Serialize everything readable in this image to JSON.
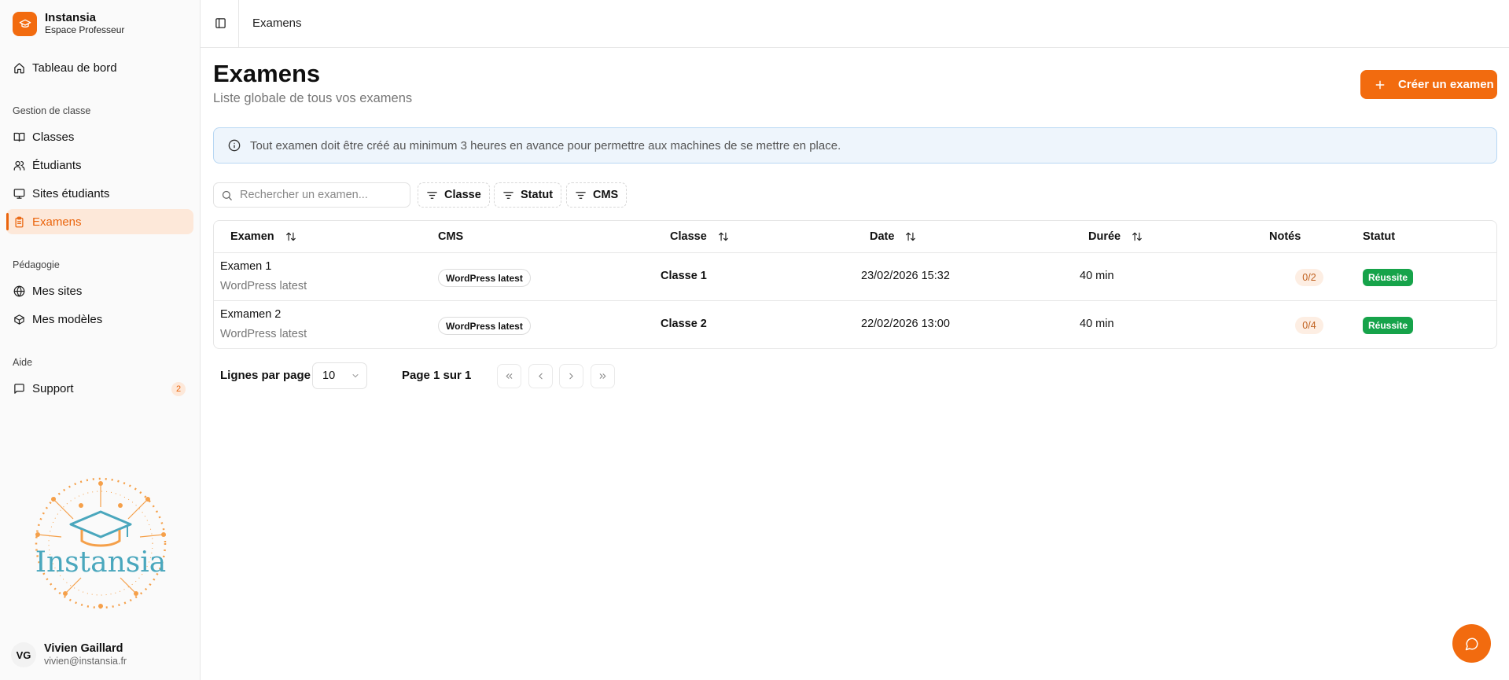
{
  "brand": {
    "name": "Instansia",
    "subtitle": "Espace Professeur"
  },
  "sidebar": {
    "dashboard": "Tableau de bord",
    "sections": [
      {
        "title": "Gestion de classe",
        "items": [
          "Classes",
          "Étudiants",
          "Sites étudiants",
          "Examens"
        ]
      },
      {
        "title": "Pédagogie",
        "items": [
          "Mes sites",
          "Mes modèles"
        ]
      },
      {
        "title": "Aide",
        "items": [
          "Support"
        ]
      }
    ],
    "support_badge": "2",
    "logo_text": "Instansia"
  },
  "user": {
    "initials": "VG",
    "name": "Vivien Gaillard",
    "email": "vivien@instansia.fr"
  },
  "topbar": {
    "breadcrumb": "Examens"
  },
  "page": {
    "title": "Examens",
    "subtitle": "Liste globale de tous vos examens",
    "create_button": "Créer un examen",
    "info": "Tout examen doit être créé au minimum 3 heures en avance pour permettre aux machines de se mettre en place."
  },
  "toolbar": {
    "search_placeholder": "Rechercher un examen...",
    "filters": [
      "Classe",
      "Statut",
      "CMS"
    ]
  },
  "table": {
    "columns": [
      "Examen",
      "CMS",
      "Classe",
      "Date",
      "Durée",
      "Notés",
      "Statut"
    ],
    "rows": [
      {
        "name": "Examen 1",
        "sub": "WordPress latest",
        "cms": "WordPress latest",
        "classe": "Classe 1",
        "date": "23/02/2026 15:32",
        "duree": "40 min",
        "notes": "0/2",
        "statut": "Réussite"
      },
      {
        "name": "Exmamen 2",
        "sub": "WordPress latest",
        "cms": "WordPress latest",
        "classe": "Classe 2",
        "date": "22/02/2026 13:00",
        "duree": "40 min",
        "notes": "0/4",
        "statut": "Réussite"
      }
    ]
  },
  "pagination": {
    "rows_label": "Lignes par page",
    "rows_value": "10",
    "page_info": "Page 1 sur 1"
  },
  "colors": {
    "accent": "#f26b0f",
    "success": "#16a34a",
    "info_bg": "#eef5fc"
  }
}
